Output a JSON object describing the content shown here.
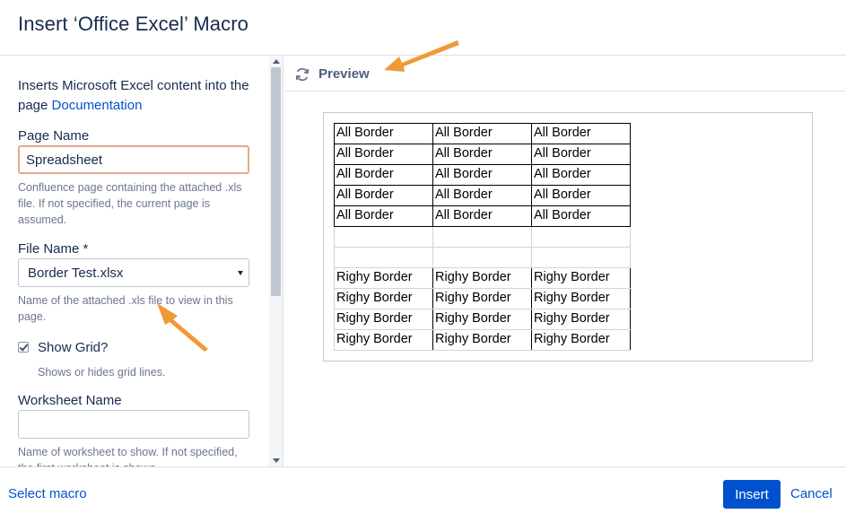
{
  "dialog": {
    "title": "Insert ‘Office Excel’ Macro"
  },
  "form": {
    "description": "Inserts Microsoft Excel content into the page",
    "documentation_link": "Documentation",
    "page_name": {
      "label": "Page Name",
      "value": "Spreadsheet",
      "help": "Confluence page containing the attached .xls file. If not specified, the current page is assumed."
    },
    "file_name": {
      "label": "File Name *",
      "value": "Border Test.xlsx",
      "help": "Name of the attached .xls file to view in this page."
    },
    "show_grid": {
      "label": "Show Grid?",
      "checked": true,
      "help": "Shows or hides grid lines."
    },
    "worksheet_name": {
      "label": "Worksheet Name",
      "value": "",
      "help": "Name of worksheet to show. If not specified, the first worksheet is shown."
    }
  },
  "preview": {
    "label": "Preview",
    "icon": "refresh-icon",
    "rows_all_border": [
      [
        "All Border",
        "All Border",
        "All Border"
      ],
      [
        "All Border",
        "All Border",
        "All Border"
      ],
      [
        "All Border",
        "All Border",
        "All Border"
      ],
      [
        "All Border",
        "All Border",
        "All Border"
      ],
      [
        "All Border",
        "All Border",
        "All Border"
      ]
    ],
    "rows_right_border": [
      [
        "Righy Border",
        "Righy Border",
        "Righy Border"
      ],
      [
        "Righy Border",
        "Righy Border",
        "Righy Border"
      ],
      [
        "Righy Border",
        "Righy Border",
        "Righy Border"
      ],
      [
        "Righy Border",
        "Righy Border",
        "Righy Border"
      ]
    ]
  },
  "footer": {
    "select_macro": "Select macro",
    "insert": "Insert",
    "cancel": "Cancel"
  },
  "colors": {
    "primary": "#0052cc",
    "annotation_arrow": "#f0922d"
  }
}
